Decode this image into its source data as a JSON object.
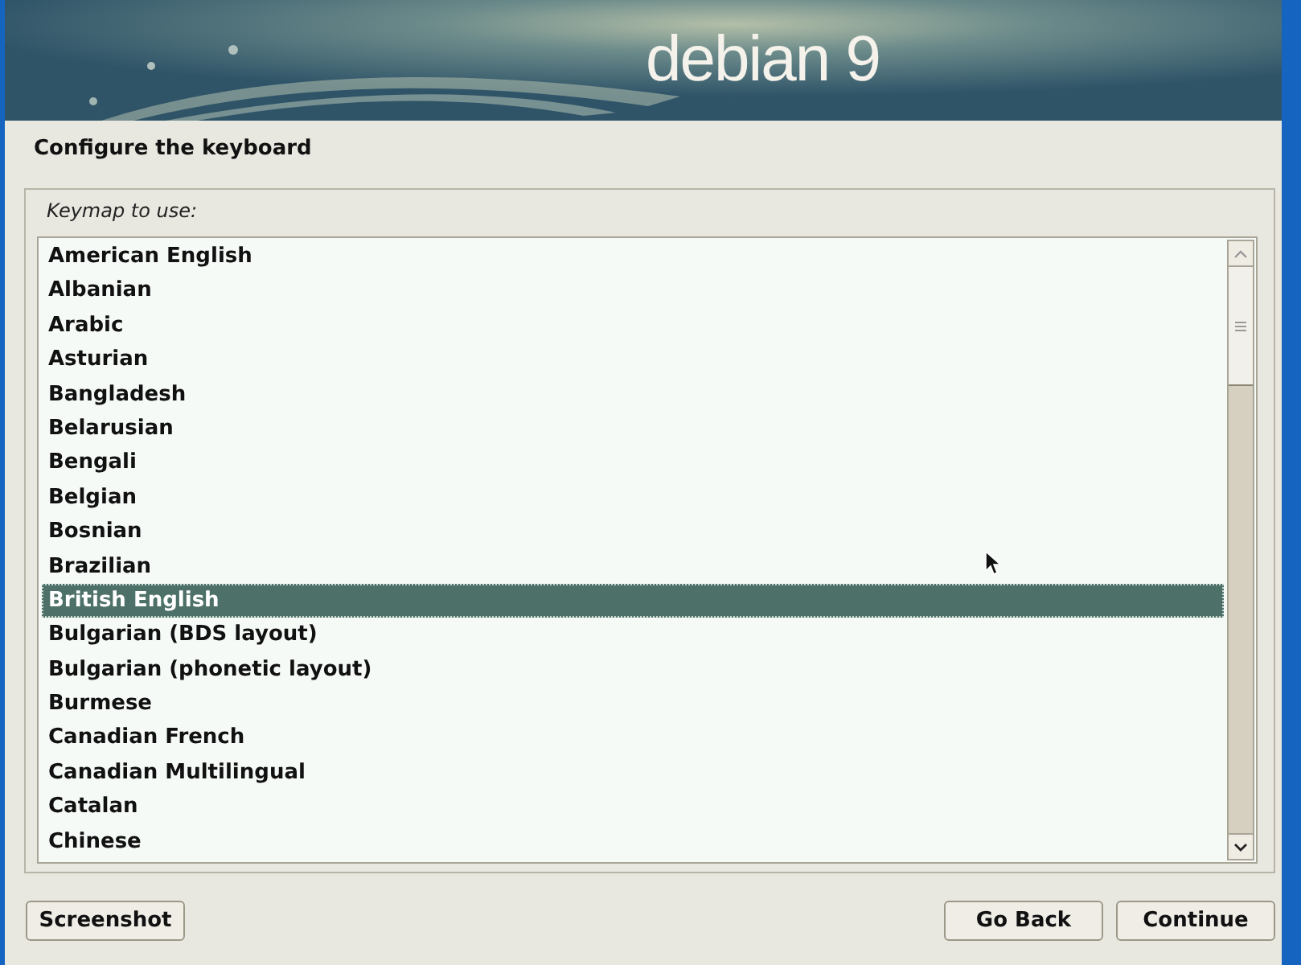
{
  "banner": {
    "logo": "debian 9"
  },
  "title": "Configure the keyboard",
  "keymap": {
    "label": "Keymap to use:",
    "items": [
      {
        "label": "American English",
        "selected": false
      },
      {
        "label": "Albanian",
        "selected": false
      },
      {
        "label": "Arabic",
        "selected": false
      },
      {
        "label": "Asturian",
        "selected": false
      },
      {
        "label": "Bangladesh",
        "selected": false
      },
      {
        "label": "Belarusian",
        "selected": false
      },
      {
        "label": "Bengali",
        "selected": false
      },
      {
        "label": "Belgian",
        "selected": false
      },
      {
        "label": "Bosnian",
        "selected": false
      },
      {
        "label": "Brazilian",
        "selected": false
      },
      {
        "label": "British English",
        "selected": true
      },
      {
        "label": "Bulgarian (BDS layout)",
        "selected": false
      },
      {
        "label": "Bulgarian (phonetic layout)",
        "selected": false
      },
      {
        "label": "Burmese",
        "selected": false
      },
      {
        "label": "Canadian French",
        "selected": false
      },
      {
        "label": "Canadian Multilingual",
        "selected": false
      },
      {
        "label": "Catalan",
        "selected": false
      },
      {
        "label": "Chinese",
        "selected": false
      }
    ]
  },
  "buttons": {
    "left": [
      "Screenshot"
    ],
    "right": [
      "Go Back",
      "Continue"
    ]
  }
}
